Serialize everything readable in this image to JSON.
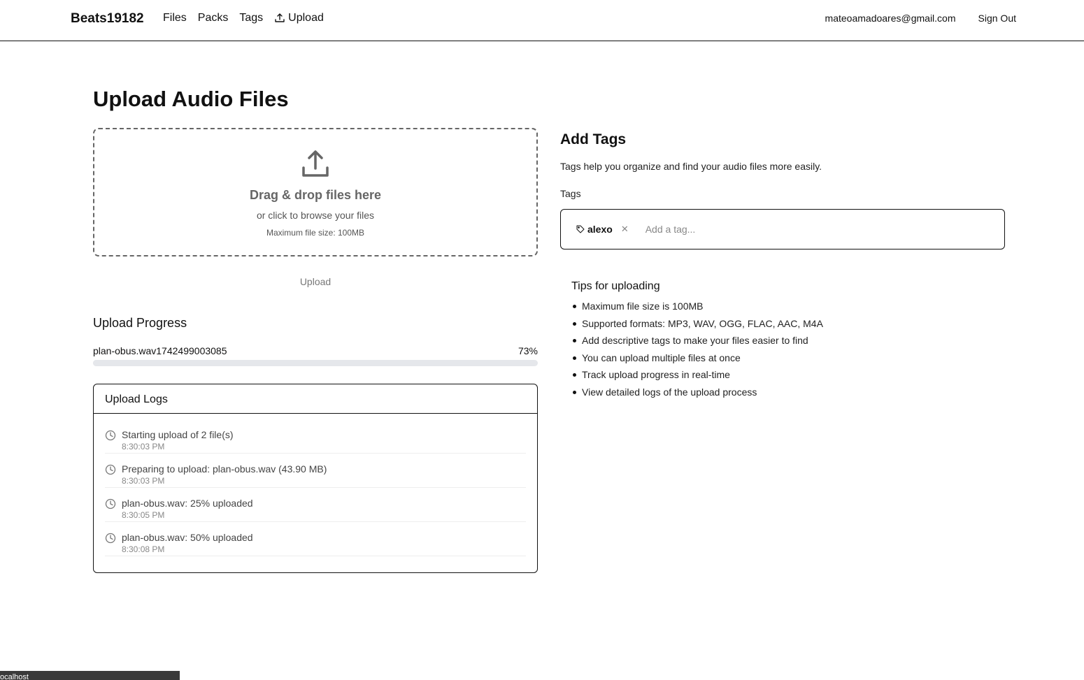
{
  "nav": {
    "brand": "Beats19182",
    "links": [
      "Files",
      "Packs",
      "Tags"
    ],
    "upload_label": "Upload",
    "user_email": "mateoamadoares@gmail.com",
    "signout_label": "Sign Out"
  },
  "page": {
    "title": "Upload Audio Files"
  },
  "dropzone": {
    "title": "Drag & drop files here",
    "subtitle": "or click to browse your files",
    "max_size": "Maximum file size: 100MB",
    "icon": "upload-icon"
  },
  "upload_button_label": "Upload",
  "progress": {
    "title": "Upload Progress",
    "file_name": "plan-obus.wav1742499003085",
    "percent_label": "73%",
    "percent": 73
  },
  "logs": {
    "title": "Upload Logs",
    "items": [
      {
        "message": "Starting upload of 2 file(s)",
        "time": "8:30:03 PM"
      },
      {
        "message": "Preparing to upload: plan-obus.wav (43.90 MB)",
        "time": "8:30:03 PM"
      },
      {
        "message": "plan-obus.wav: 25% uploaded",
        "time": "8:30:05 PM"
      },
      {
        "message": "plan-obus.wav: 50% uploaded",
        "time": "8:30:08 PM"
      }
    ]
  },
  "tags": {
    "title": "Add Tags",
    "description": "Tags help you organize and find your audio files more easily.",
    "label": "Tags",
    "chips": [
      "alexo"
    ],
    "input_placeholder": "Add a tag..."
  },
  "tips": {
    "title": "Tips for uploading",
    "items": [
      "Maximum file size is 100MB",
      "Supported formats: MP3, WAV, OGG, FLAC, AAC, M4A",
      "Add descriptive tags to make your files easier to find",
      "You can upload multiple files at once",
      "Track upload progress in real-time",
      "View detailed logs of the upload process"
    ]
  },
  "status_bar": "ocalhost",
  "colors": {
    "text": "#111111",
    "muted": "#666666",
    "border": "#111111",
    "progress_track": "#e5e7eb"
  }
}
